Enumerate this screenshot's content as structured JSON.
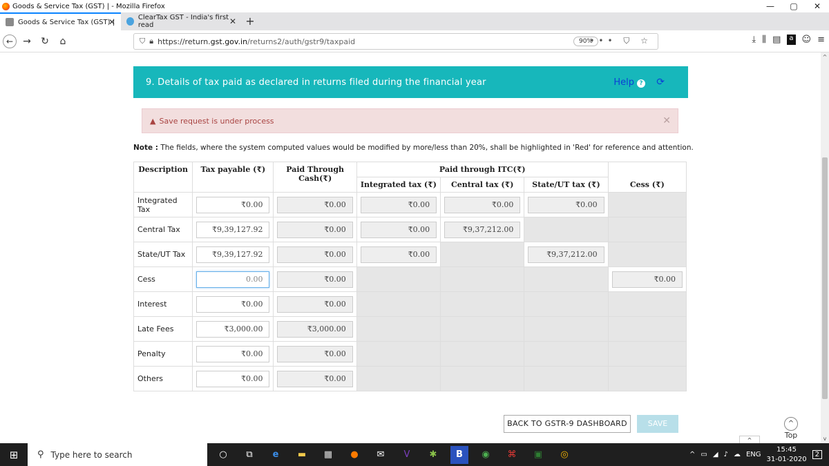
{
  "window": {
    "title": "Goods & Service Tax (GST) | - Mozilla Firefox",
    "controls": [
      "—",
      "▢",
      "✕"
    ]
  },
  "tabs": [
    {
      "label": "Goods & Service Tax (GST) |",
      "icon": "gst-emblem-icon"
    },
    {
      "label": "ClearTax GST - India's first read",
      "icon": "cleartax-icon"
    }
  ],
  "nav": {
    "url_prefix": "https://return.",
    "url_host": "gst.gov.in",
    "url_path": "/returns2/auth/gstr9/taxpaid",
    "zoom": "90%",
    "menu_dots": "•••"
  },
  "page": {
    "title": "9. Details of tax paid as declared in returns filed during the financial year",
    "help_label": "Help",
    "alert_text": "Save request is under process",
    "note_bold": "Note :",
    "note_text": " The fields, where the system computed values would be modified by more/less than 20%, shall be highlighted in 'Red' for reference and attention."
  },
  "table": {
    "headers": {
      "description": "Description",
      "tax_payable": "Tax payable (₹)",
      "paid_cash": "Paid Through Cash(₹)",
      "paid_itc": "Paid through ITC(₹)",
      "integrated": "Integrated tax (₹)",
      "central": "Central tax (₹)",
      "state": "State/UT tax (₹)",
      "cess": "Cess (₹)"
    },
    "rows": [
      {
        "desc": "Integrated Tax",
        "payable": "₹0.00",
        "cash": "₹0.00",
        "igst": "₹0.00",
        "cgst": "₹0.00",
        "sgst": "₹0.00",
        "cess": ""
      },
      {
        "desc": "Central Tax",
        "payable": "₹9,39,127.92",
        "cash": "₹0.00",
        "igst": "₹0.00",
        "cgst": "₹9,37,212.00",
        "sgst": "",
        "cess": ""
      },
      {
        "desc": "State/UT Tax",
        "payable": "₹9,39,127.92",
        "cash": "₹0.00",
        "igst": "₹0.00",
        "cgst": "",
        "sgst": "₹9,37,212.00",
        "cess": ""
      },
      {
        "desc": "Cess",
        "payable": "0.00",
        "cash": "₹0.00",
        "igst": "",
        "cgst": "",
        "sgst": "",
        "cess": "₹0.00"
      },
      {
        "desc": "Interest",
        "payable": "₹0.00",
        "cash": "₹0.00",
        "igst": "",
        "cgst": "",
        "sgst": "",
        "cess": ""
      },
      {
        "desc": "Late Fees",
        "payable": "₹3,000.00",
        "cash": "₹3,000.00",
        "igst": "",
        "cgst": "",
        "sgst": "",
        "cess": ""
      },
      {
        "desc": "Penalty",
        "payable": "₹0.00",
        "cash": "₹0.00",
        "igst": "",
        "cgst": "",
        "sgst": "",
        "cess": ""
      },
      {
        "desc": "Others",
        "payable": "₹0.00",
        "cash": "₹0.00",
        "igst": "",
        "cgst": "",
        "sgst": "",
        "cess": ""
      }
    ]
  },
  "buttons": {
    "back": "BACK TO GSTR-9 DASHBOARD",
    "save": "SAVE",
    "top": "Top"
  },
  "taskbar": {
    "search_placeholder": "Type here to search",
    "language": "ENG",
    "time": "15:45",
    "date": "31-01-2020",
    "notifications": "2"
  },
  "colors": {
    "header_bg": "#17b7bb",
    "alert_bg": "#f2dede",
    "alert_text": "#a94442",
    "help_link": "#0b3fd6",
    "save_disabled": "#b8dfe9"
  }
}
